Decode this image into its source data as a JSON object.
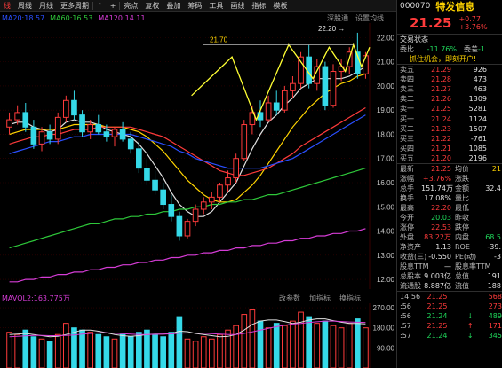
{
  "toolbar": {
    "items": [
      "线",
      "周线",
      "月线",
      "更多周期",
      "|",
      "↑",
      "+",
      "叠加",
      "复权",
      "叠加",
      "画线",
      "筹码",
      "指标",
      "模板",
      "-",
      "□"
    ],
    "labels": {
      "daily": "线",
      "weekly": "周线",
      "monthly": "月线",
      "more": "更多周期",
      "highlight": "亮点",
      "fq": "复权",
      "overlay": "叠加",
      "tools": "工具",
      "chips": "筹码",
      "draw": "画线",
      "indicator": "指标",
      "template": "模板"
    }
  },
  "ma": {
    "ma20": "MA20:18.57",
    "ma60": "MA60:16.53",
    "ma120": "MA120:14.11",
    "deep_review": "深股通",
    "set_ma": "设置均线"
  },
  "colors": {
    "up": "#ff3b3b",
    "down": "#35d9e8",
    "ma5": "#e0e0e0",
    "ma10": "#ffd400",
    "ma20": "#ff3b3b",
    "ma30": "#2a4fff",
    "ma60": "#2ec83a",
    "ma120": "#d63cd6",
    "pattern": "#ffff33"
  },
  "chart_data": {
    "type": "candlestick",
    "y_ticks": [
      "22.00",
      "21.00",
      "20.00",
      "19.00",
      "18.00",
      "17.00",
      "16.00",
      "15.00",
      "14.00",
      "13.00",
      "12.00"
    ],
    "ylim": [
      11.6,
      22.6
    ],
    "annotations": [
      "21.70",
      "22.20 →"
    ],
    "candles": [
      [
        18.3,
        18.9,
        18.0,
        18.6
      ],
      [
        18.6,
        19.2,
        18.4,
        18.9
      ],
      [
        18.9,
        19.3,
        18.1,
        18.3
      ],
      [
        18.3,
        18.6,
        17.4,
        17.6
      ],
      [
        17.6,
        18.3,
        17.3,
        18.1
      ],
      [
        18.1,
        18.4,
        17.6,
        17.8
      ],
      [
        17.8,
        18.9,
        17.6,
        18.7
      ],
      [
        18.7,
        19.6,
        18.5,
        19.4
      ],
      [
        19.4,
        19.8,
        18.6,
        18.8
      ],
      [
        18.8,
        19.0,
        17.9,
        18.1
      ],
      [
        18.1,
        18.6,
        17.8,
        18.4
      ],
      [
        18.4,
        18.8,
        18.0,
        18.1
      ],
      [
        18.1,
        18.4,
        17.7,
        17.9
      ],
      [
        17.9,
        18.3,
        17.5,
        18.2
      ],
      [
        18.2,
        18.5,
        17.7,
        17.8
      ],
      [
        17.8,
        18.1,
        17.2,
        17.4
      ],
      [
        17.4,
        17.7,
        16.4,
        16.6
      ],
      [
        16.6,
        17.0,
        15.9,
        16.1
      ],
      [
        16.1,
        16.5,
        15.5,
        15.7
      ],
      [
        15.7,
        16.0,
        14.9,
        15.1
      ],
      [
        15.1,
        15.5,
        14.4,
        14.6
      ],
      [
        14.6,
        14.8,
        13.6,
        13.8
      ],
      [
        13.8,
        14.5,
        13.7,
        14.4
      ],
      [
        14.4,
        15.1,
        14.2,
        14.9
      ],
      [
        14.9,
        15.4,
        14.7,
        15.2
      ],
      [
        15.2,
        15.6,
        14.9,
        15.4
      ],
      [
        15.4,
        16.0,
        15.2,
        15.9
      ],
      [
        15.9,
        16.5,
        15.6,
        16.2
      ],
      [
        16.2,
        17.2,
        16.0,
        17.0
      ],
      [
        17.0,
        18.6,
        16.9,
        18.4
      ],
      [
        18.4,
        19.2,
        18.0,
        18.9
      ],
      [
        18.9,
        19.4,
        18.3,
        18.6
      ],
      [
        18.6,
        19.6,
        18.5,
        19.3
      ],
      [
        19.3,
        19.8,
        18.8,
        19.0
      ],
      [
        19.0,
        20.0,
        18.9,
        19.8
      ],
      [
        19.8,
        20.4,
        19.5,
        20.1
      ],
      [
        20.1,
        21.4,
        19.9,
        21.2
      ],
      [
        21.2,
        21.7,
        19.9,
        20.1
      ],
      [
        20.1,
        21.1,
        19.8,
        20.8
      ],
      [
        20.8,
        21.0,
        19.0,
        19.2
      ],
      [
        19.2,
        20.9,
        19.1,
        20.6
      ],
      [
        20.6,
        21.1,
        20.2,
        20.8
      ],
      [
        20.8,
        21.6,
        20.5,
        21.4
      ],
      [
        21.4,
        22.2,
        20.3,
        20.5
      ],
      [
        20.5,
        21.4,
        20.3,
        21.25
      ]
    ],
    "series": [
      {
        "name": "MA5",
        "values": [
          18.4,
          18.5,
          18.5,
          18.3,
          18.2,
          18.1,
          18.2,
          18.5,
          18.6,
          18.5,
          18.5,
          18.4,
          18.2,
          18.1,
          18.0,
          17.9,
          17.6,
          17.2,
          16.7,
          16.2,
          15.6,
          15.1,
          14.8,
          14.6,
          14.6,
          14.8,
          15.2,
          15.6,
          16.0,
          16.7,
          17.4,
          18.0,
          18.5,
          18.8,
          19.2,
          19.5,
          19.9,
          20.1,
          20.3,
          20.3,
          20.3,
          20.3,
          20.4,
          20.6,
          20.8
        ]
      },
      {
        "name": "MA10",
        "values": [
          18.0,
          18.1,
          18.2,
          18.2,
          18.2,
          18.2,
          18.2,
          18.3,
          18.4,
          18.4,
          18.4,
          18.4,
          18.3,
          18.3,
          18.3,
          18.2,
          18.1,
          17.9,
          17.6,
          17.3,
          16.9,
          16.5,
          16.1,
          15.8,
          15.5,
          15.3,
          15.2,
          15.2,
          15.3,
          15.6,
          15.9,
          16.3,
          16.8,
          17.3,
          17.8,
          18.3,
          18.7,
          19.1,
          19.4,
          19.7,
          19.9,
          20.1,
          20.2,
          20.4,
          20.5
        ]
      },
      {
        "name": "MA20",
        "values": [
          17.6,
          17.7,
          17.8,
          17.9,
          17.9,
          18.0,
          18.0,
          18.1,
          18.2,
          18.2,
          18.2,
          18.3,
          18.3,
          18.3,
          18.3,
          18.3,
          18.2,
          18.1,
          18.0,
          17.9,
          17.7,
          17.5,
          17.3,
          17.1,
          16.9,
          16.7,
          16.5,
          16.4,
          16.3,
          16.3,
          16.4,
          16.5,
          16.6,
          16.8,
          17.0,
          17.2,
          17.5,
          17.7,
          17.9,
          18.1,
          18.3,
          18.5,
          18.7,
          18.9,
          19.1
        ]
      },
      {
        "name": "MA30",
        "values": [
          17.2,
          17.3,
          17.4,
          17.5,
          17.6,
          17.7,
          17.7,
          17.8,
          17.9,
          17.9,
          18.0,
          18.0,
          18.0,
          18.0,
          18.0,
          18.0,
          17.9,
          17.8,
          17.7,
          17.6,
          17.5,
          17.3,
          17.2,
          17.0,
          16.9,
          16.8,
          16.7,
          16.6,
          16.6,
          16.6,
          16.6,
          16.6,
          16.7,
          16.8,
          16.9,
          17.0,
          17.2,
          17.4,
          17.6,
          17.8,
          18.0,
          18.2,
          18.4,
          18.6,
          18.8
        ]
      },
      {
        "name": "MA60",
        "values": [
          13.3,
          13.4,
          13.5,
          13.6,
          13.7,
          13.8,
          13.9,
          14.0,
          14.1,
          14.2,
          14.3,
          14.3,
          14.4,
          14.5,
          14.5,
          14.6,
          14.6,
          14.7,
          14.7,
          14.8,
          14.8,
          14.9,
          14.9,
          15.0,
          15.0,
          15.1,
          15.1,
          15.2,
          15.2,
          15.3,
          15.3,
          15.4,
          15.5,
          15.5,
          15.6,
          15.7,
          15.8,
          15.9,
          16.0,
          16.1,
          16.2,
          16.3,
          16.4,
          16.5,
          16.6
        ]
      },
      {
        "name": "MA120",
        "values": [
          11.9,
          11.9,
          12.0,
          12.0,
          12.1,
          12.1,
          12.2,
          12.2,
          12.3,
          12.3,
          12.4,
          12.4,
          12.5,
          12.5,
          12.6,
          12.6,
          12.7,
          12.7,
          12.8,
          12.8,
          12.9,
          12.9,
          13.0,
          13.0,
          13.1,
          13.1,
          13.2,
          13.2,
          13.3,
          13.3,
          13.4,
          13.4,
          13.5,
          13.5,
          13.6,
          13.6,
          13.7,
          13.7,
          13.8,
          13.8,
          13.9,
          13.9,
          14.0,
          14.0,
          14.1
        ]
      }
    ],
    "volume": {
      "label": "MAVOL2:163.775万",
      "ticks": [
        "270.00",
        "180.00",
        "90.00"
      ],
      "ylim": [
        0,
        290
      ],
      "values": [
        160,
        150,
        170,
        140,
        130,
        120,
        150,
        200,
        180,
        170,
        160,
        150,
        140,
        130,
        150,
        140,
        160,
        170,
        150,
        140,
        160,
        230,
        130,
        120,
        140,
        130,
        150,
        170,
        190,
        240,
        260,
        210,
        180,
        200,
        190,
        210,
        250,
        230,
        200,
        210,
        190,
        180,
        200,
        220,
        180
      ],
      "ma1": [
        150,
        152,
        155,
        150,
        145,
        140,
        142,
        150,
        160,
        170,
        170,
        165,
        158,
        150,
        145,
        142,
        145,
        150,
        152,
        152,
        155,
        165,
        163,
        155,
        150,
        145,
        140,
        142,
        150,
        170,
        195,
        210,
        215,
        215,
        208,
        200,
        205,
        215,
        220,
        220,
        212,
        205,
        200,
        200,
        198
      ],
      "ma2": [
        140,
        142,
        144,
        146,
        146,
        145,
        145,
        146,
        148,
        152,
        155,
        158,
        158,
        156,
        154,
        152,
        150,
        150,
        151,
        152,
        153,
        156,
        157,
        157,
        156,
        154,
        152,
        150,
        150,
        155,
        162,
        170,
        178,
        185,
        192,
        197,
        200,
        204,
        207,
        210,
        210,
        208,
        206,
        205,
        204
      ]
    }
  },
  "vol_menu": {
    "more": "改参数",
    "add": "加指标",
    "replace": "换指标"
  },
  "panel": {
    "code": "000070",
    "name": "特发信息",
    "price": "21.25",
    "change": "+0.77",
    "change_pct": "+3.76%",
    "status_label": "交易状态",
    "weibi_label": "委比",
    "weibi": "-11.76%",
    "weicha_label": "委差",
    "weicha": "-1",
    "banner": "抓住机会，即刻开户!",
    "asks": [
      {
        "label": "卖五",
        "price": "21.29",
        "vol": "926"
      },
      {
        "label": "卖四",
        "price": "21.28",
        "vol": "473"
      },
      {
        "label": "卖三",
        "price": "21.27",
        "vol": "463"
      },
      {
        "label": "卖二",
        "price": "21.26",
        "vol": "1309"
      },
      {
        "label": "卖一",
        "price": "21.25",
        "vol": "5281"
      }
    ],
    "bids": [
      {
        "label": "买一",
        "price": "21.24",
        "vol": "1124"
      },
      {
        "label": "买二",
        "price": "21.23",
        "vol": "1507"
      },
      {
        "label": "买三",
        "price": "21.22",
        "vol": "-761"
      },
      {
        "label": "买四",
        "price": "21.21",
        "vol": "1085"
      },
      {
        "label": "买五",
        "price": "21.20",
        "vol": "2196"
      }
    ],
    "stats": [
      {
        "l1": "最新",
        "v1": "21.25",
        "c1": "red",
        "l2": "均价",
        "v2": "21",
        "c2": "yellow"
      },
      {
        "l1": "涨幅",
        "v1": "+3.76%",
        "c1": "red",
        "l2": "涨跌",
        "v2": "",
        "c2": "red"
      },
      {
        "l1": "总手",
        "v1": "151.74万",
        "c1": "white",
        "l2": "金额",
        "v2": "32.4",
        "c2": "white"
      },
      {
        "l1": "换手",
        "v1": "17.08%",
        "c1": "white",
        "l2": "量比",
        "v2": "",
        "c2": "white"
      },
      {
        "l1": "最高",
        "v1": "22.20",
        "c1": "red",
        "l2": "最低",
        "v2": "",
        "c2": "white"
      },
      {
        "l1": "今开",
        "v1": "20.03",
        "c1": "green",
        "l2": "昨收",
        "v2": "",
        "c2": "white"
      },
      {
        "l1": "涨停",
        "v1": "22.53",
        "c1": "red",
        "l2": "跌停",
        "v2": "",
        "c2": "green"
      },
      {
        "l1": "外盘",
        "v1": "83.22万",
        "c1": "red",
        "l2": "内盘",
        "v2": "68.5",
        "c2": "green"
      },
      {
        "l1": "净资产",
        "v1": "1.13",
        "c1": "white",
        "l2": "ROE",
        "v2": "-39.",
        "c2": "white"
      },
      {
        "l1": "收益(三)",
        "v1": "-0.550",
        "c1": "white",
        "l2": "PE(动)",
        "v2": "-3",
        "c2": "white"
      },
      {
        "l1": "股息TTM",
        "v1": "—",
        "c1": "white",
        "l2": "股息率TTM",
        "v2": "",
        "c2": "white"
      },
      {
        "l1": "总股本",
        "v1": "9.003亿",
        "c1": "white",
        "l2": "总值",
        "v2": "191",
        "c2": "white"
      },
      {
        "l1": "流通股",
        "v1": "8.887亿",
        "c1": "white",
        "l2": "流值",
        "v2": "188",
        "c2": "white"
      }
    ],
    "ticks": [
      {
        "t": "14:56",
        "p": "21.25",
        "v": "568",
        "arrow": "",
        "c": "red"
      },
      {
        "t": ":56",
        "p": "21.25",
        "v": "273",
        "arrow": "",
        "c": "red"
      },
      {
        "t": ":56",
        "p": "21.24",
        "v": "489",
        "arrow": "↓",
        "c": "green"
      },
      {
        "t": ":57",
        "p": "21.25",
        "v": "171",
        "arrow": "↑",
        "c": "red"
      },
      {
        "t": ":57",
        "p": "21.24",
        "v": "345",
        "arrow": "↓",
        "c": "green"
      }
    ]
  }
}
